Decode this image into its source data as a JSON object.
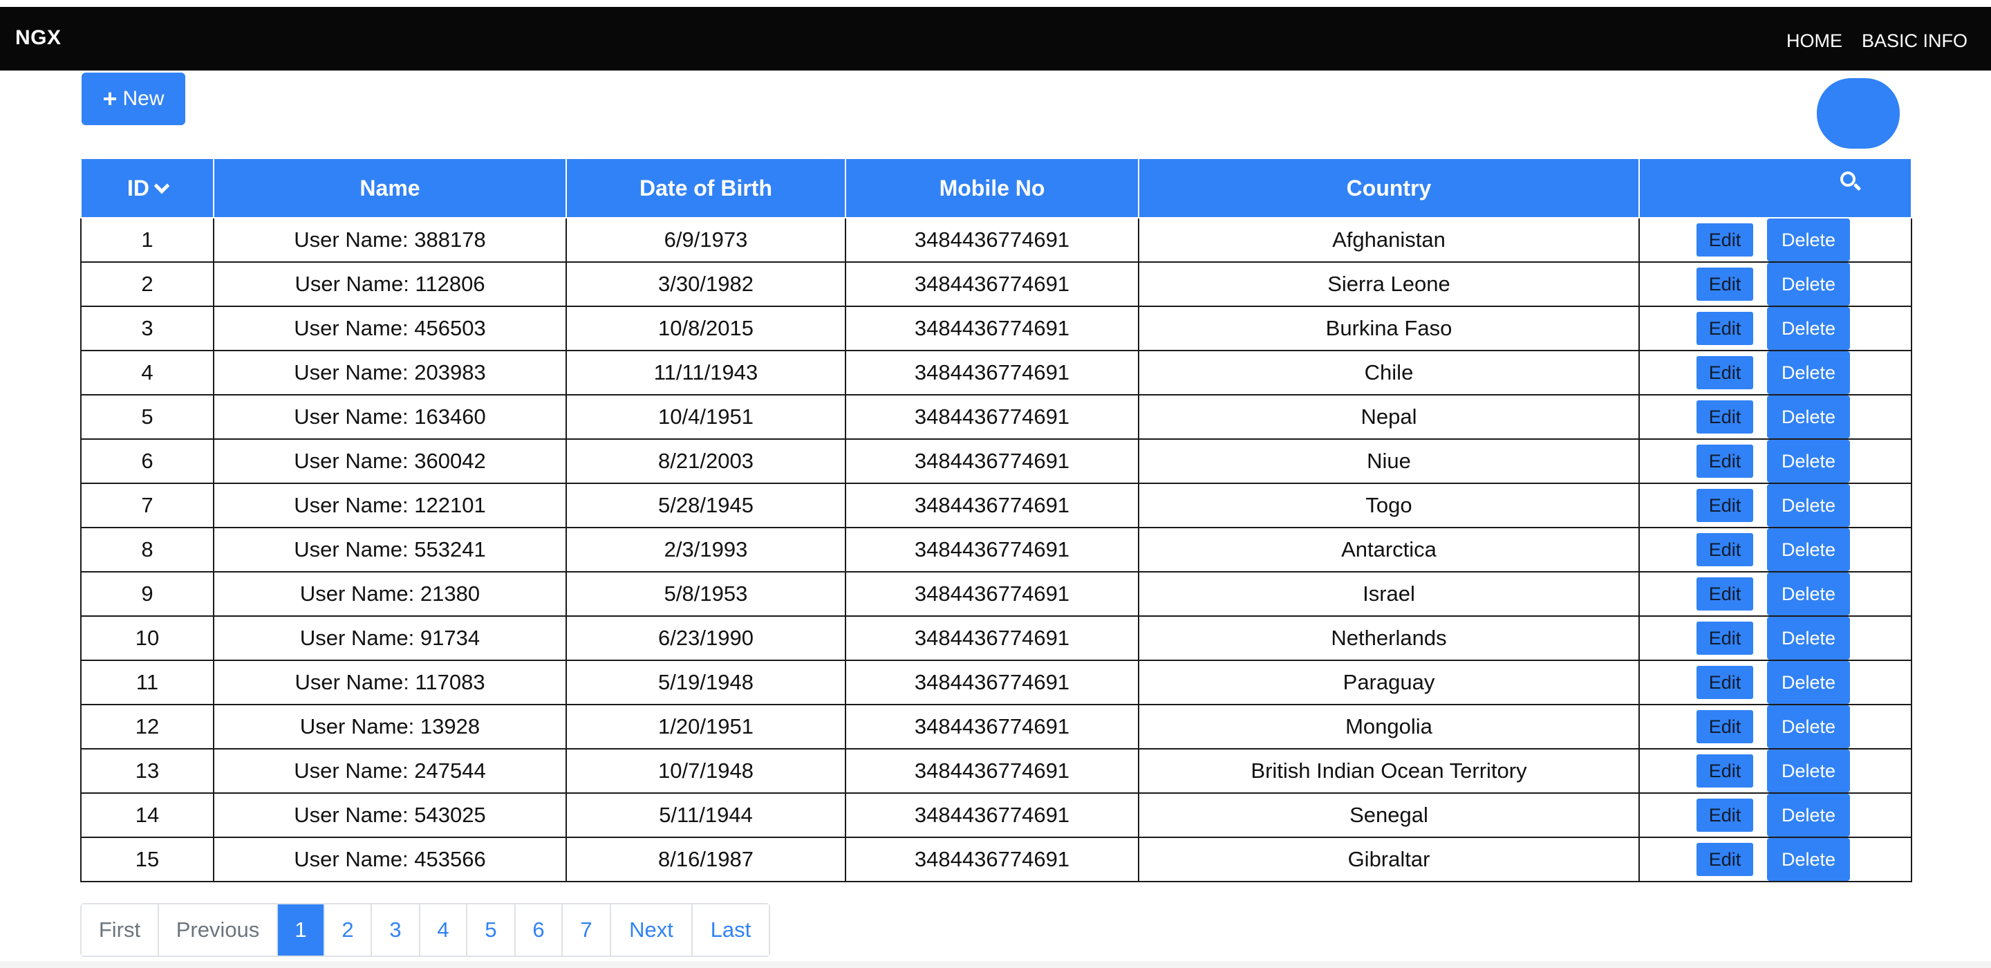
{
  "navbar": {
    "brand": "NGX",
    "links": [
      {
        "label": "HOME"
      },
      {
        "label": "BASIC INFO"
      }
    ]
  },
  "toolbar": {
    "new_label": "New",
    "new_icon": "plus-icon"
  },
  "table": {
    "headers": {
      "id": "ID",
      "name": "Name",
      "dob": "Date of Birth",
      "mobile": "Mobile No",
      "country": "Country",
      "search_icon": "search-icon",
      "sort_icon": "chevron-down-icon"
    },
    "edit_label": "Edit",
    "delete_label": "Delete",
    "rows": [
      {
        "id": "1",
        "name": "User Name: 388178",
        "dob": "6/9/1973",
        "mobile": "3484436774691",
        "country": "Afghanistan"
      },
      {
        "id": "2",
        "name": "User Name: 112806",
        "dob": "3/30/1982",
        "mobile": "3484436774691",
        "country": "Sierra Leone"
      },
      {
        "id": "3",
        "name": "User Name: 456503",
        "dob": "10/8/2015",
        "mobile": "3484436774691",
        "country": "Burkina Faso"
      },
      {
        "id": "4",
        "name": "User Name: 203983",
        "dob": "11/11/1943",
        "mobile": "3484436774691",
        "country": "Chile"
      },
      {
        "id": "5",
        "name": "User Name: 163460",
        "dob": "10/4/1951",
        "mobile": "3484436774691",
        "country": "Nepal"
      },
      {
        "id": "6",
        "name": "User Name: 360042",
        "dob": "8/21/2003",
        "mobile": "3484436774691",
        "country": "Niue"
      },
      {
        "id": "7",
        "name": "User Name: 122101",
        "dob": "5/28/1945",
        "mobile": "3484436774691",
        "country": "Togo"
      },
      {
        "id": "8",
        "name": "User Name: 553241",
        "dob": "2/3/1993",
        "mobile": "3484436774691",
        "country": "Antarctica"
      },
      {
        "id": "9",
        "name": "User Name: 21380",
        "dob": "5/8/1953",
        "mobile": "3484436774691",
        "country": "Israel"
      },
      {
        "id": "10",
        "name": "User Name: 91734",
        "dob": "6/23/1990",
        "mobile": "3484436774691",
        "country": "Netherlands"
      },
      {
        "id": "11",
        "name": "User Name: 117083",
        "dob": "5/19/1948",
        "mobile": "3484436774691",
        "country": "Paraguay"
      },
      {
        "id": "12",
        "name": "User Name: 13928",
        "dob": "1/20/1951",
        "mobile": "3484436774691",
        "country": "Mongolia"
      },
      {
        "id": "13",
        "name": "User Name: 247544",
        "dob": "10/7/1948",
        "mobile": "3484436774691",
        "country": "British Indian Ocean Territory"
      },
      {
        "id": "14",
        "name": "User Name: 543025",
        "dob": "5/11/1944",
        "mobile": "3484436774691",
        "country": "Senegal"
      },
      {
        "id": "15",
        "name": "User Name: 453566",
        "dob": "8/16/1987",
        "mobile": "3484436774691",
        "country": "Gibraltar"
      }
    ]
  },
  "pagination": {
    "first": "First",
    "previous": "Previous",
    "pages": [
      "1",
      "2",
      "3",
      "4",
      "5",
      "6",
      "7"
    ],
    "current": "1",
    "next": "Next",
    "last": "Last"
  },
  "colors": {
    "primary": "#3182f6",
    "navbar": "#080808"
  }
}
